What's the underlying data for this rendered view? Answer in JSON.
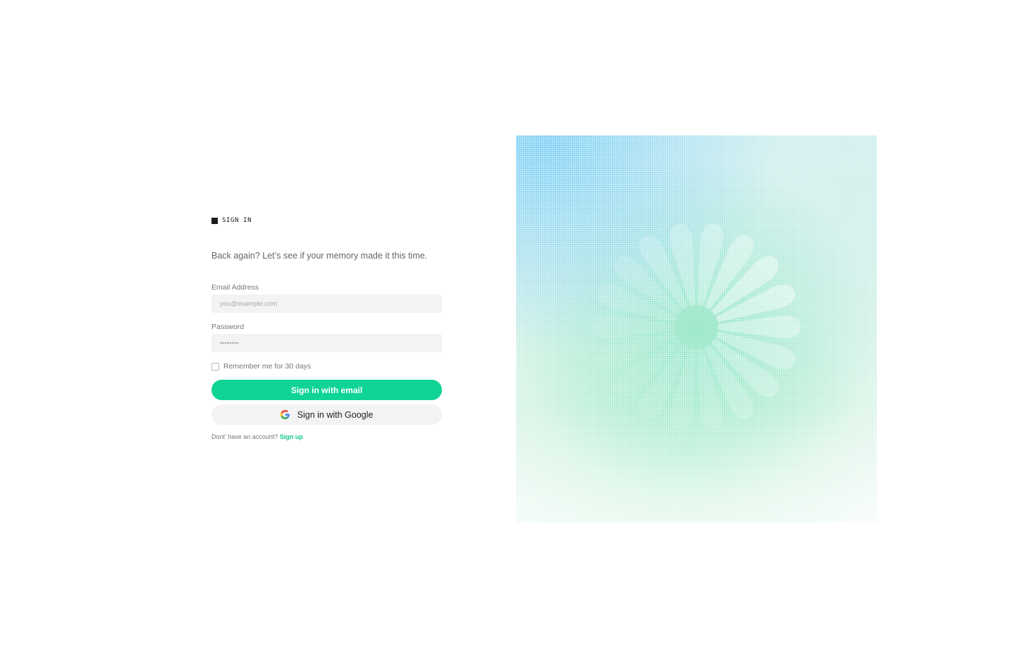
{
  "auth": {
    "tag": "SIGN IN",
    "subtitle": "Back again? Let’s see if your memory made it this time.",
    "email": {
      "label": "Email Address",
      "placeholder": "you@example.com",
      "value": ""
    },
    "password": {
      "label": "Password",
      "placeholder": "••••••••",
      "value": ""
    },
    "remember": {
      "label": "Remember me for 30 days",
      "checked": false
    },
    "primary_button": "Sign in with email",
    "google_button": "Sign in with Google",
    "signup_prompt": "Dont' have an account?",
    "signup_link": "Sign up"
  },
  "theme": {
    "accent": "#10d496",
    "link": "#10c98f",
    "input_bg": "#f3f3f3",
    "text_muted": "#777777"
  },
  "icons": {
    "tag": "square-icon",
    "google": "google-logo-icon",
    "hero": "flower-logo-icon"
  }
}
